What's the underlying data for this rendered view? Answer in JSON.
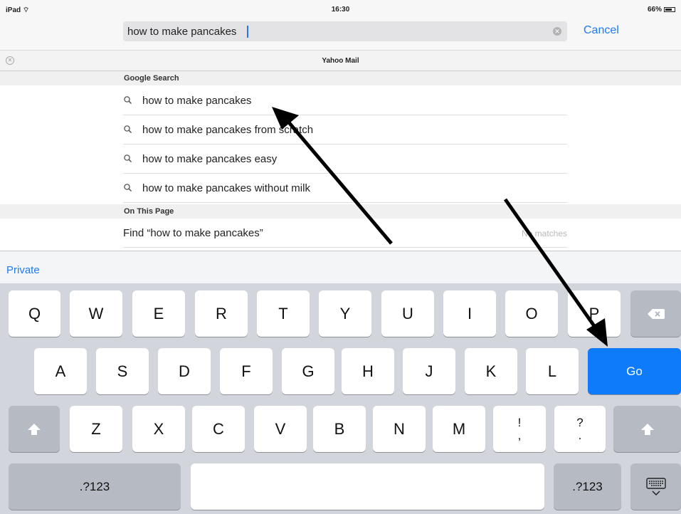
{
  "status": {
    "carrier": "iPad",
    "time": "16:30",
    "battery": "66%"
  },
  "address_bar": {
    "query": "how to make pancakes",
    "cancel_label": "Cancel"
  },
  "tab": {
    "title": "Yahoo Mail"
  },
  "google_search": {
    "header": "Google Search",
    "suggestions": [
      "how to make pancakes",
      "how to make pancakes from scratch",
      "how to make pancakes easy",
      "how to make pancakes without milk"
    ]
  },
  "on_this_page": {
    "header": "On This Page",
    "find_label": "Find “how to make pancakes”",
    "result": "No matches"
  },
  "private_label": "Private",
  "keyboard": {
    "row1": [
      "Q",
      "W",
      "E",
      "R",
      "T",
      "Y",
      "U",
      "I",
      "O",
      "P"
    ],
    "row2": [
      "A",
      "S",
      "D",
      "F",
      "G",
      "H",
      "J",
      "K",
      "L"
    ],
    "go_label": "Go",
    "row3": [
      "Z",
      "X",
      "C",
      "V",
      "B",
      "N",
      "M"
    ],
    "punct1_top": "!",
    "punct1_bottom": ",",
    "punct2_top": "?",
    "punct2_bottom": ".",
    "numbers_label": ".?123",
    "icons": {
      "backspace": "backspace-icon",
      "shift": "shift-icon",
      "hide_keyboard": "keyboard-hide-icon",
      "search": "magnifier-icon"
    }
  },
  "colors": {
    "accent": "#1e7bf0",
    "go_key": "#0d7bfa",
    "keyboard_bg": "#d2d5db"
  }
}
